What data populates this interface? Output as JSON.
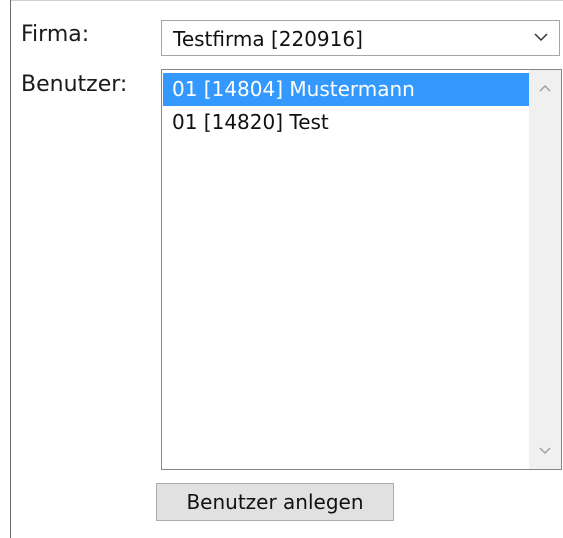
{
  "form": {
    "firma_label": "Firma:",
    "benutzer_label": "Benutzer:"
  },
  "firma_select": {
    "selected_value": "Testfirma [220916]"
  },
  "benutzer_list": {
    "items": [
      {
        "label": "01 [14804] Mustermann",
        "selected": true
      },
      {
        "label": "01 [14820] Test",
        "selected": false
      }
    ]
  },
  "actions": {
    "create_user_label": "Benutzer anlegen"
  },
  "colors": {
    "selection": "#3399ff",
    "button_bg": "#e1e1e1",
    "scrollbar_bg": "#f0f0f0"
  },
  "icons": {
    "combo_arrow": "chevron-down-icon",
    "scroll_up": "chevron-up-icon",
    "scroll_down": "chevron-down-icon"
  }
}
